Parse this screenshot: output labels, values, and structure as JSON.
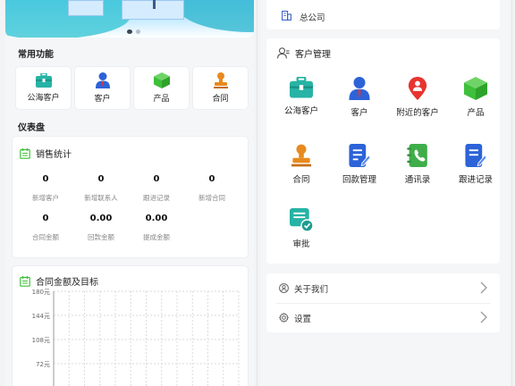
{
  "left": {
    "quick_title": "常用功能",
    "quick": [
      {
        "label": "公海客户",
        "icon": "briefcase-icon"
      },
      {
        "label": "客户",
        "icon": "person-icon"
      },
      {
        "label": "产品",
        "icon": "cube-icon"
      },
      {
        "label": "合同",
        "icon": "stamp-icon"
      }
    ],
    "dashboard_title": "仪表盘",
    "sales": {
      "title": "销售统计",
      "row1": [
        {
          "value": "0",
          "label": "新增客户"
        },
        {
          "value": "0",
          "label": "新增联系人"
        },
        {
          "value": "0",
          "label": "跟进记录"
        },
        {
          "value": "0",
          "label": "新增合同"
        }
      ],
      "row2": [
        {
          "value": "0",
          "label": "合同金额"
        },
        {
          "value": "0.00",
          "label": "回款金额"
        },
        {
          "value": "0.00",
          "label": "提成金额"
        }
      ]
    },
    "chart": {
      "title": "合同金额及目标"
    }
  },
  "chart_data": {
    "type": "line",
    "title": "合同金额及目标",
    "y_ticks": [
      "180元",
      "144元",
      "108元",
      "72元"
    ],
    "ylim": [
      0,
      180
    ],
    "grid": true,
    "series": []
  },
  "right": {
    "company": "总公司",
    "cm_title": "客户管理",
    "cm_items": [
      {
        "label": "公海客户",
        "icon": "briefcase-icon"
      },
      {
        "label": "客户",
        "icon": "person-icon"
      },
      {
        "label": "附近的客户",
        "icon": "location-pin-icon"
      },
      {
        "label": "产品",
        "icon": "cube-icon"
      },
      {
        "label": "合同",
        "icon": "stamp-icon"
      },
      {
        "label": "回款管理",
        "icon": "document-edit-icon"
      },
      {
        "label": "通讯录",
        "icon": "contacts-icon"
      },
      {
        "label": "跟进记录",
        "icon": "followup-doc-icon"
      },
      {
        "label": "审批",
        "icon": "approval-icon"
      }
    ],
    "menu": [
      {
        "label": "关于我们",
        "icon": "info-user-icon"
      },
      {
        "label": "设置",
        "icon": "gear-icon"
      }
    ]
  },
  "colors": {
    "teal": "#27b3a5",
    "blue": "#2d63d8",
    "red": "#e8342f",
    "green": "#3fbf3a",
    "orange": "#e88a1e"
  }
}
